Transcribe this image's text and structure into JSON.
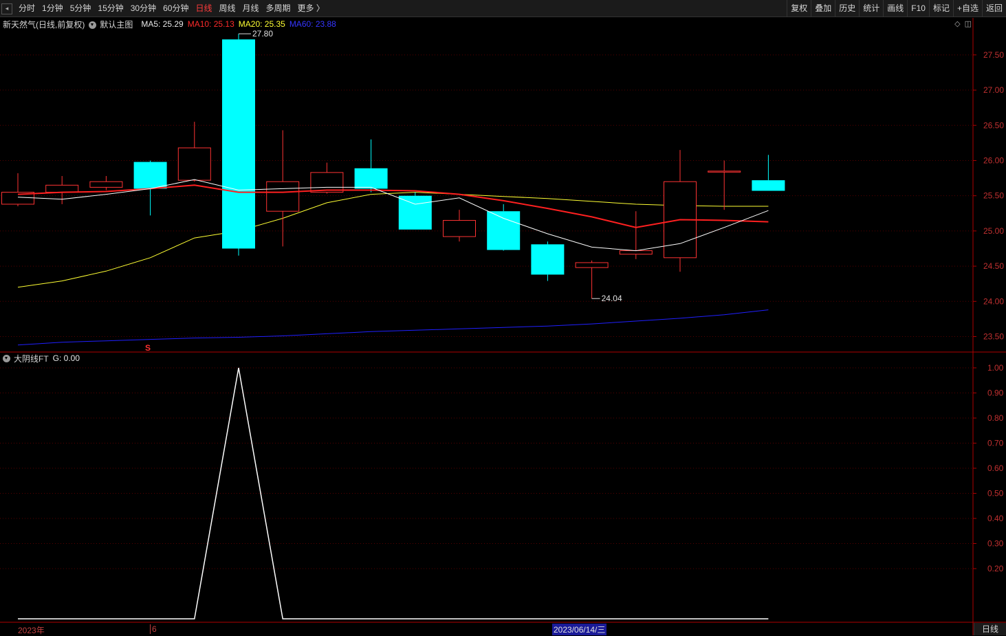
{
  "toolbar": {
    "periods": [
      "分时",
      "1分钟",
      "5分钟",
      "15分钟",
      "30分钟",
      "60分钟",
      "日线",
      "周线",
      "月线",
      "多周期",
      "更多 〉"
    ],
    "active_period": "日线",
    "right_buttons": [
      "复权",
      "叠加",
      "历史",
      "统计",
      "画线",
      "F10",
      "标记",
      "+自选",
      "返回"
    ]
  },
  "main_info": {
    "title": "新天然气(日线,前复权)",
    "template": "默认主图",
    "ma5": "MA5: 25.29",
    "ma10": "MA10: 25.13",
    "ma20": "MA20: 25.35",
    "ma60": "MA60: 23.88"
  },
  "indicator_info": {
    "name": "大阴线FT",
    "value": "G: 0.00"
  },
  "colors": {
    "up": "#ff3333",
    "down": "#00ffff",
    "ma5": "#ffffff",
    "ma10": "#ff2020",
    "ma20": "#ffff33",
    "ma60": "#2020ff",
    "axis": "#b00000"
  },
  "bottom": {
    "year_label": "2023年",
    "month_label": "6",
    "selected_date": "2023/06/14/三",
    "period_label": "日线"
  },
  "chart_data": {
    "type": "candlestick",
    "price_axis": {
      "ylim": [
        23.3,
        27.85
      ],
      "ticks": [
        "27.50",
        "27.00",
        "26.50",
        "26.00",
        "25.50",
        "25.00",
        "24.50",
        "24.00",
        "23.50"
      ]
    },
    "indicator_axis": {
      "ylim": [
        0,
        1.0
      ],
      "ticks": [
        "1.00",
        "0.90",
        "0.80",
        "0.70",
        "0.60",
        "0.50",
        "0.40",
        "0.30",
        "0.20"
      ]
    },
    "annotations": {
      "high": "27.80",
      "low": "24.04"
    },
    "candles": [
      {
        "open": 25.38,
        "close": 25.55,
        "high": 25.82,
        "low": 25.35
      },
      {
        "open": 25.55,
        "close": 25.65,
        "high": 25.78,
        "low": 25.38
      },
      {
        "open": 25.62,
        "close": 25.7,
        "high": 25.78,
        "low": 25.58
      },
      {
        "open": 25.98,
        "close": 25.6,
        "high": 26.0,
        "low": 25.22
      },
      {
        "open": 25.72,
        "close": 26.18,
        "high": 26.55,
        "low": 25.7
      },
      {
        "open": 27.72,
        "close": 24.75,
        "high": 27.8,
        "low": 24.65
      },
      {
        "open": 25.28,
        "close": 25.7,
        "high": 26.43,
        "low": 24.78
      },
      {
        "open": 25.55,
        "close": 25.83,
        "high": 25.97,
        "low": 25.53
      },
      {
        "open": 25.89,
        "close": 25.6,
        "high": 26.3,
        "low": 25.55
      },
      {
        "open": 25.5,
        "close": 25.02,
        "high": 25.55,
        "low": 25.02
      },
      {
        "open": 24.92,
        "close": 25.15,
        "high": 25.3,
        "low": 24.85
      },
      {
        "open": 25.28,
        "close": 24.73,
        "high": 25.38,
        "low": 24.72
      },
      {
        "open": 24.81,
        "close": 24.38,
        "high": 24.85,
        "low": 24.29
      },
      {
        "open": 24.48,
        "close": 24.55,
        "high": 24.58,
        "low": 24.04
      },
      {
        "open": 24.67,
        "close": 24.72,
        "high": 25.28,
        "low": 24.6
      },
      {
        "open": 24.62,
        "close": 25.7,
        "high": 26.15,
        "low": 24.42
      },
      {
        "open": 25.85,
        "close": 25.85,
        "high": 26.0,
        "low": 25.3
      },
      {
        "open": 25.72,
        "close": 25.57,
        "high": 26.08,
        "low": 25.57
      }
    ],
    "ma5": [
      25.48,
      25.45,
      25.52,
      25.6,
      25.73,
      25.58,
      25.6,
      25.62,
      25.62,
      25.38,
      25.47,
      25.18,
      24.96,
      24.77,
      24.72,
      24.82,
      25.05,
      25.29
    ],
    "ma10": [
      25.52,
      25.55,
      25.56,
      25.6,
      25.65,
      25.55,
      25.55,
      25.58,
      25.58,
      25.57,
      25.52,
      25.43,
      25.32,
      25.2,
      25.05,
      25.16,
      25.15,
      25.13
    ],
    "ma20": [
      24.2,
      24.29,
      24.43,
      24.62,
      24.9,
      25.0,
      25.18,
      25.4,
      25.52,
      25.55,
      25.52,
      25.49,
      25.46,
      25.42,
      25.38,
      25.36,
      25.35,
      25.35
    ],
    "ma60": [
      23.38,
      23.42,
      23.44,
      23.46,
      23.48,
      23.49,
      23.51,
      23.54,
      23.57,
      23.59,
      23.61,
      23.63,
      23.65,
      23.68,
      23.72,
      23.76,
      23.81,
      23.88
    ],
    "signal_g": [
      0,
      0,
      0,
      0,
      0,
      1,
      0,
      0,
      0,
      0,
      0,
      0,
      0,
      0,
      0,
      0,
      0,
      0
    ]
  }
}
